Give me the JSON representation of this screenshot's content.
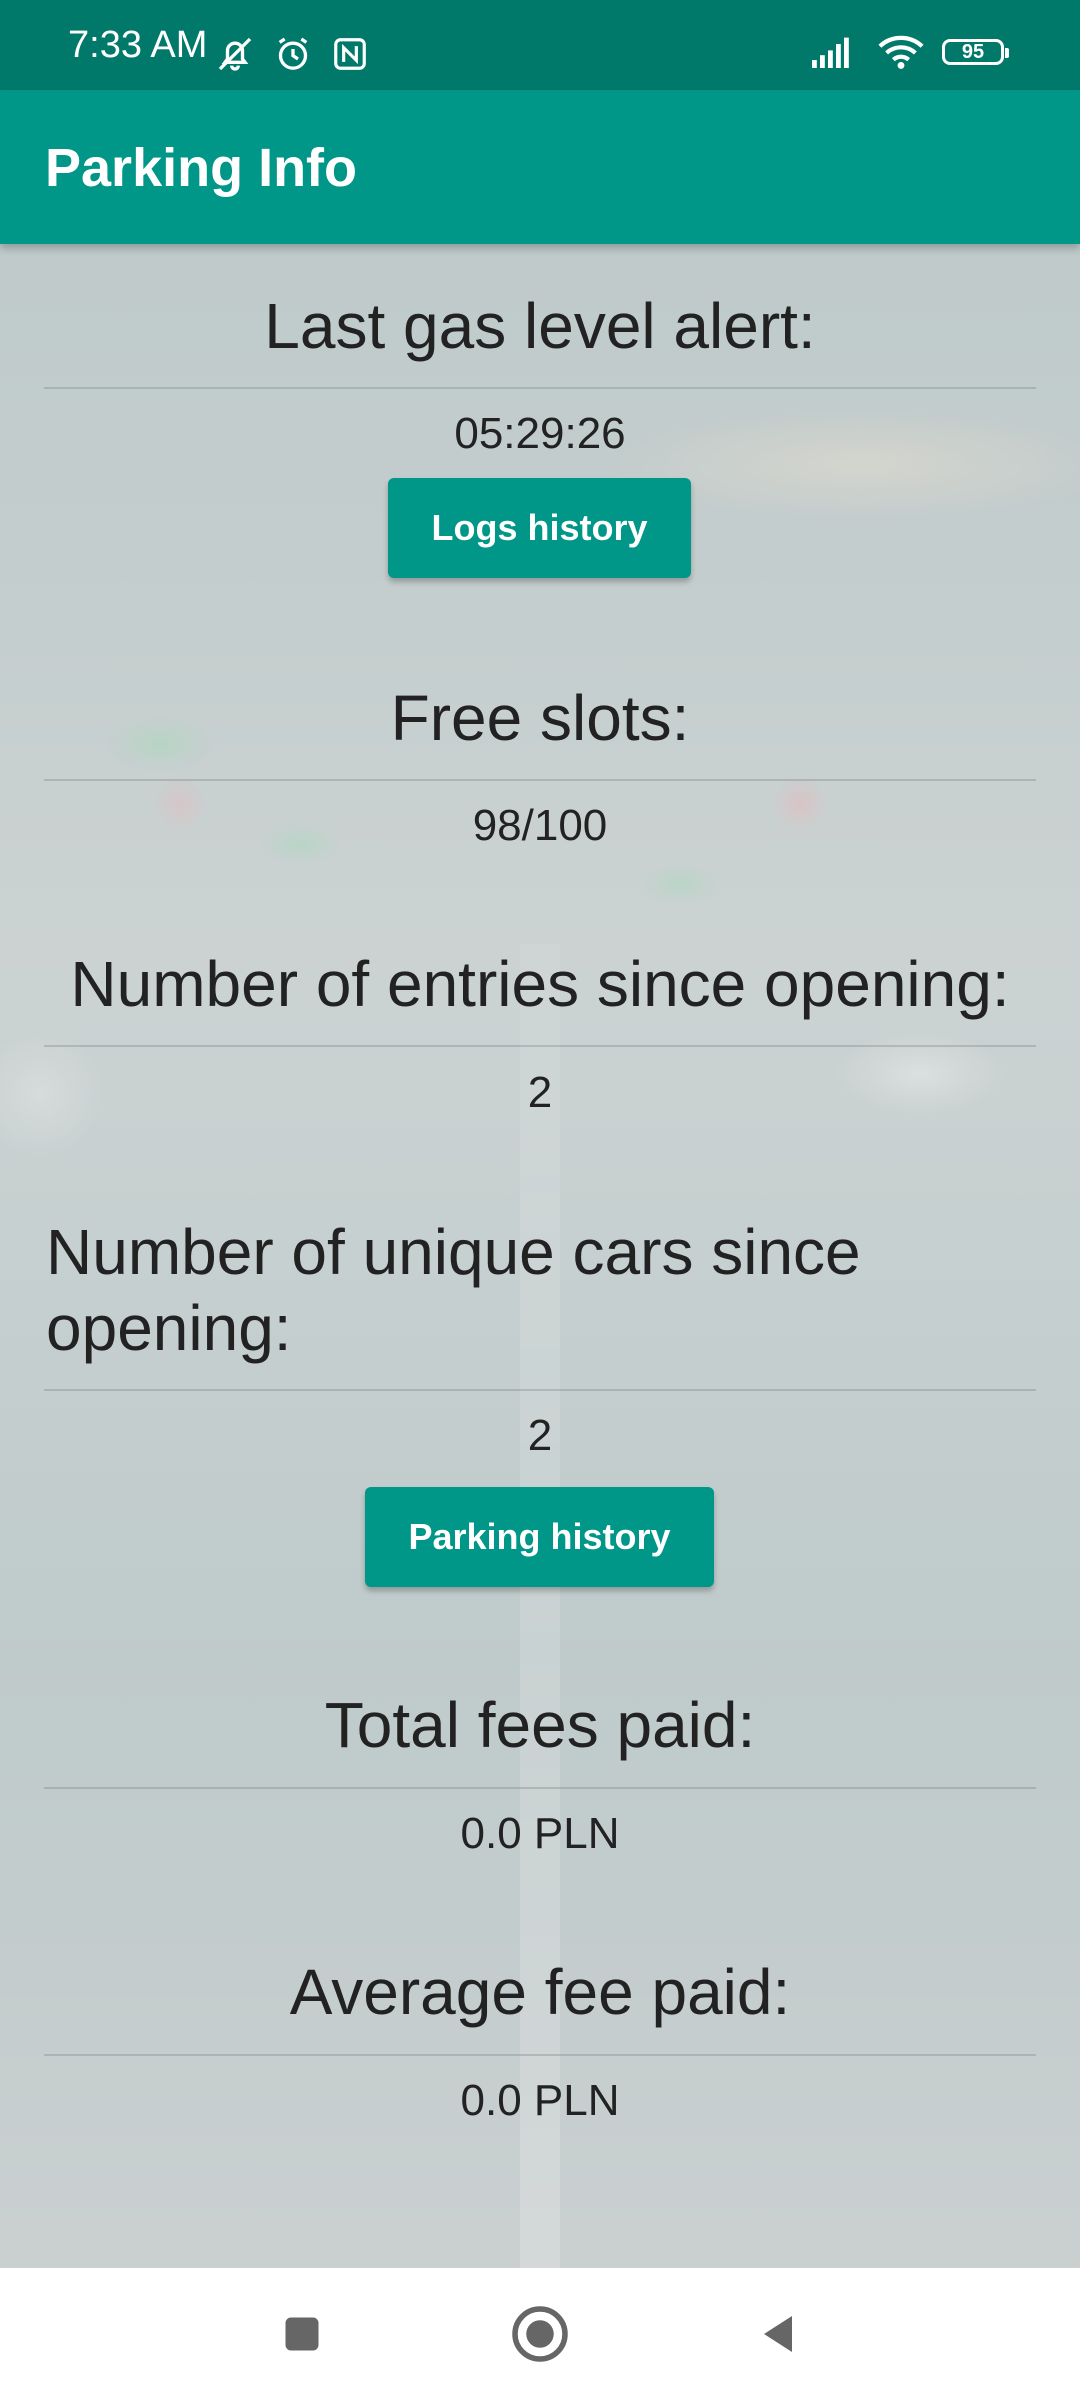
{
  "status_bar": {
    "time": "7:33 AM",
    "battery": "95"
  },
  "app_bar": {
    "title": "Parking Info"
  },
  "gas_alert": {
    "label": "Last gas level alert:",
    "value": "05:29:26",
    "button": "Logs history"
  },
  "free_slots": {
    "label": "Free slots:",
    "value": "98/100"
  },
  "entries": {
    "label": "Number of entries since opening:",
    "value": "2"
  },
  "unique_cars": {
    "label": "Number of unique cars since opening:",
    "value": "2",
    "button": "Parking history"
  },
  "total_fees": {
    "label": "Total fees paid:",
    "value": "0.0 PLN"
  },
  "average_fee": {
    "label": "Average fee paid:",
    "value": "0.0 PLN"
  },
  "colors": {
    "status_bar": "#00796b",
    "app_bar": "#009688",
    "button": "#009688"
  }
}
